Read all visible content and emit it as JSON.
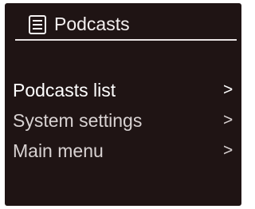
{
  "header": {
    "icon": "list-document-icon",
    "title": "Podcasts"
  },
  "menu": {
    "items": [
      {
        "label": "Podcasts list",
        "arrow": ">",
        "selected": true
      },
      {
        "label": "System settings",
        "arrow": ">",
        "selected": false
      },
      {
        "label": "Main menu",
        "arrow": ">",
        "selected": false
      }
    ]
  },
  "colors": {
    "screen_background": "#1f1414",
    "text": "#f4f0f0",
    "divider": "#e9e4e4"
  }
}
